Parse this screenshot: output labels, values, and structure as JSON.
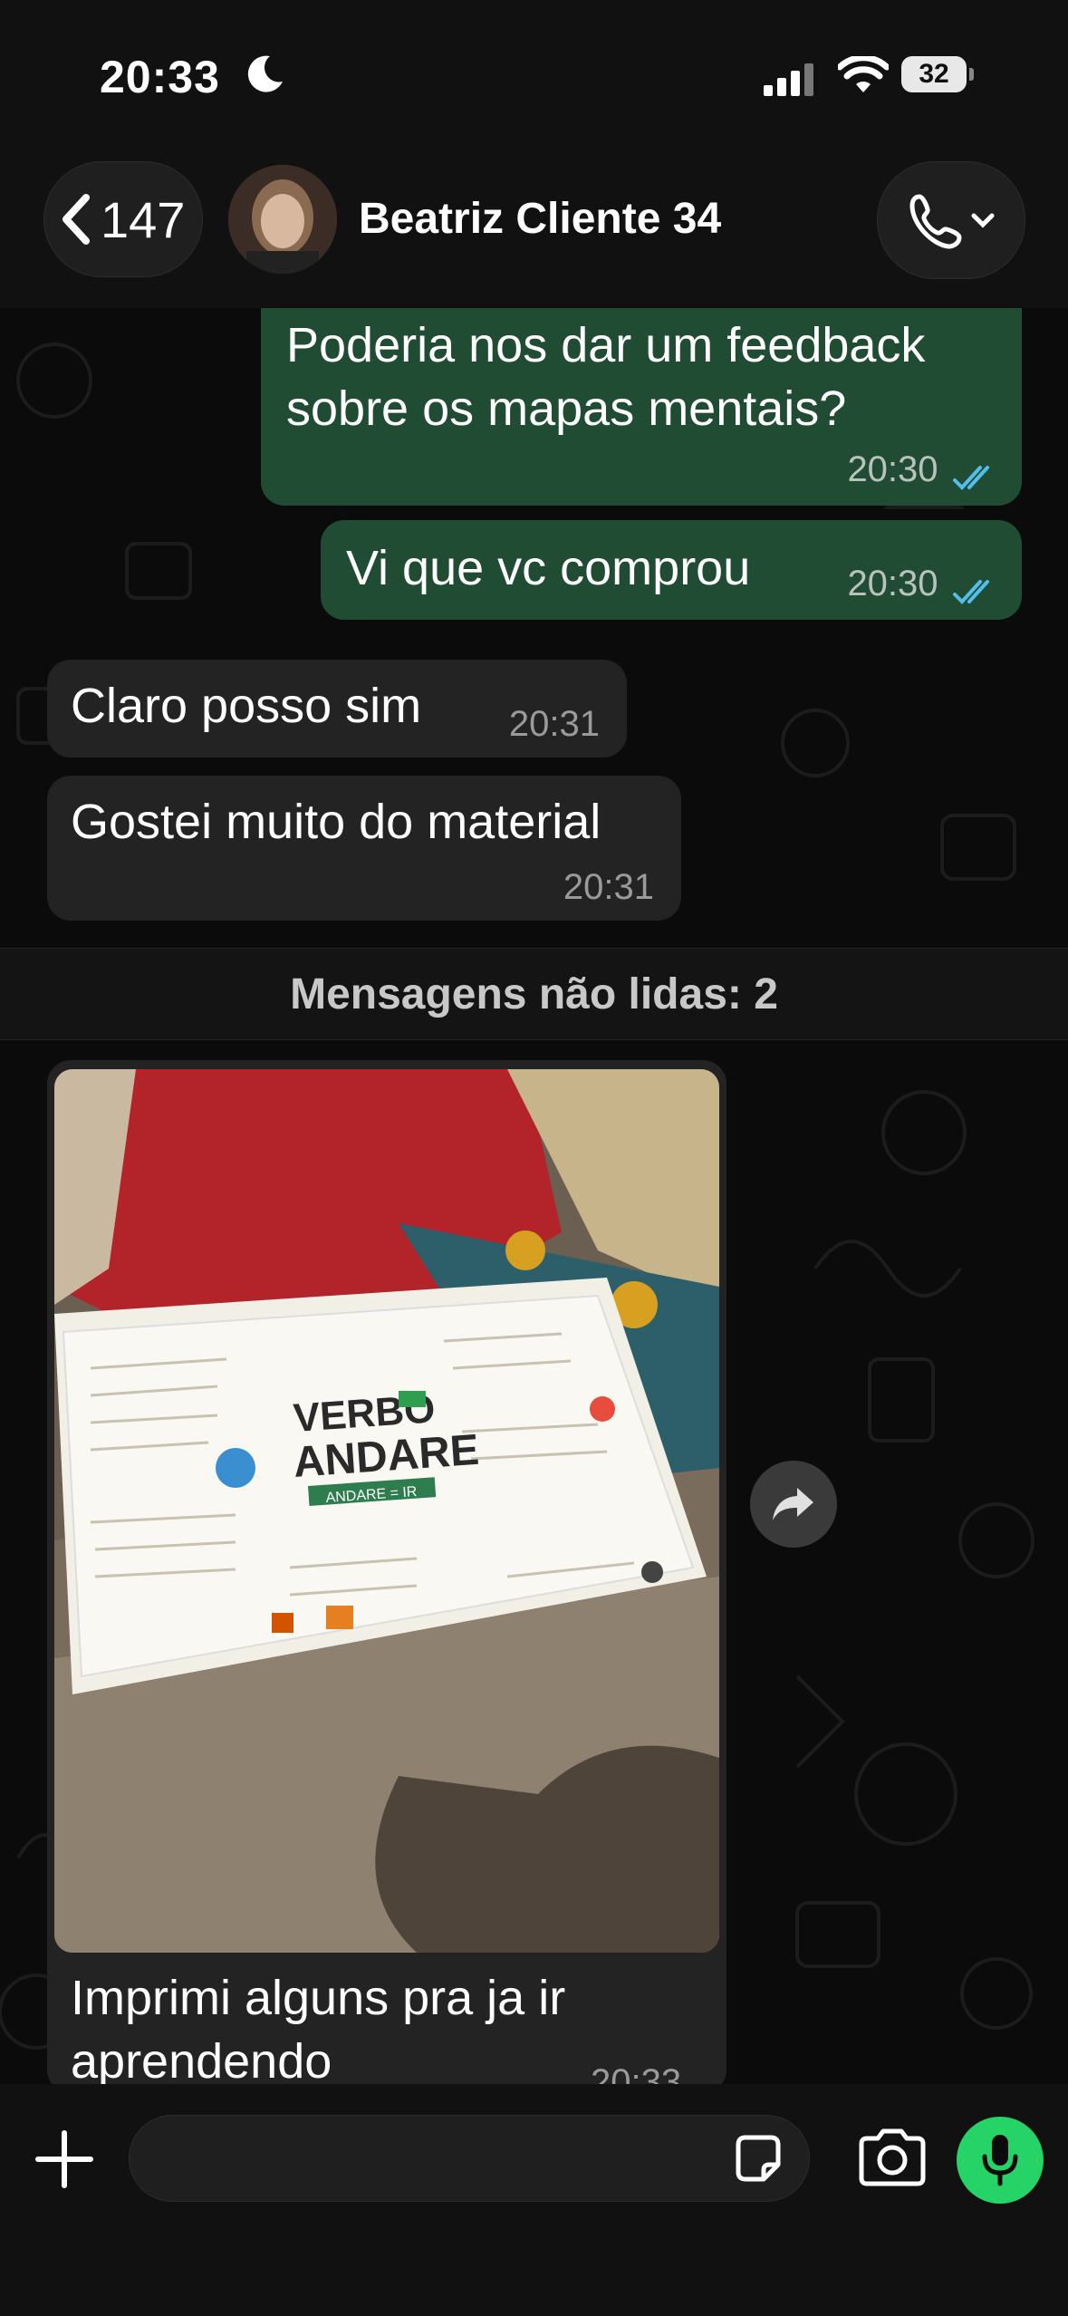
{
  "status_bar": {
    "time": "20:33",
    "battery": "32"
  },
  "header": {
    "back_count": "147",
    "contact_name": "Beatriz Cliente 34"
  },
  "messages": [
    {
      "direction": "outgoing",
      "text_line1": "Poderia nos dar um feedback",
      "text_line2": "sobre os mapas mentais?",
      "time": "20:30",
      "read": true
    },
    {
      "direction": "outgoing",
      "text": "Vi que vc comprou",
      "time": "20:30",
      "read": true
    },
    {
      "direction": "incoming",
      "text": "Claro posso sim",
      "time": "20:31"
    },
    {
      "direction": "incoming",
      "text": "Gostei muito do material",
      "time": "20:31"
    }
  ],
  "unread_divider": "Mensagens não lidas: 2",
  "photo_message": {
    "caption_line1": "Imprimi alguns pra ja ir",
    "caption_line2": "aprendendo",
    "time": "20:33",
    "photo_title_line1": "VERBO",
    "photo_title_line2": "ANDARE",
    "photo_subtitle": "ANDARE = IR"
  },
  "input": {
    "placeholder": ""
  },
  "colors": {
    "outgoing_bubble": "#1f4c33",
    "incoming_bubble": "#232323",
    "read_tick": "#53bdeb",
    "mic_button": "#25d366"
  }
}
